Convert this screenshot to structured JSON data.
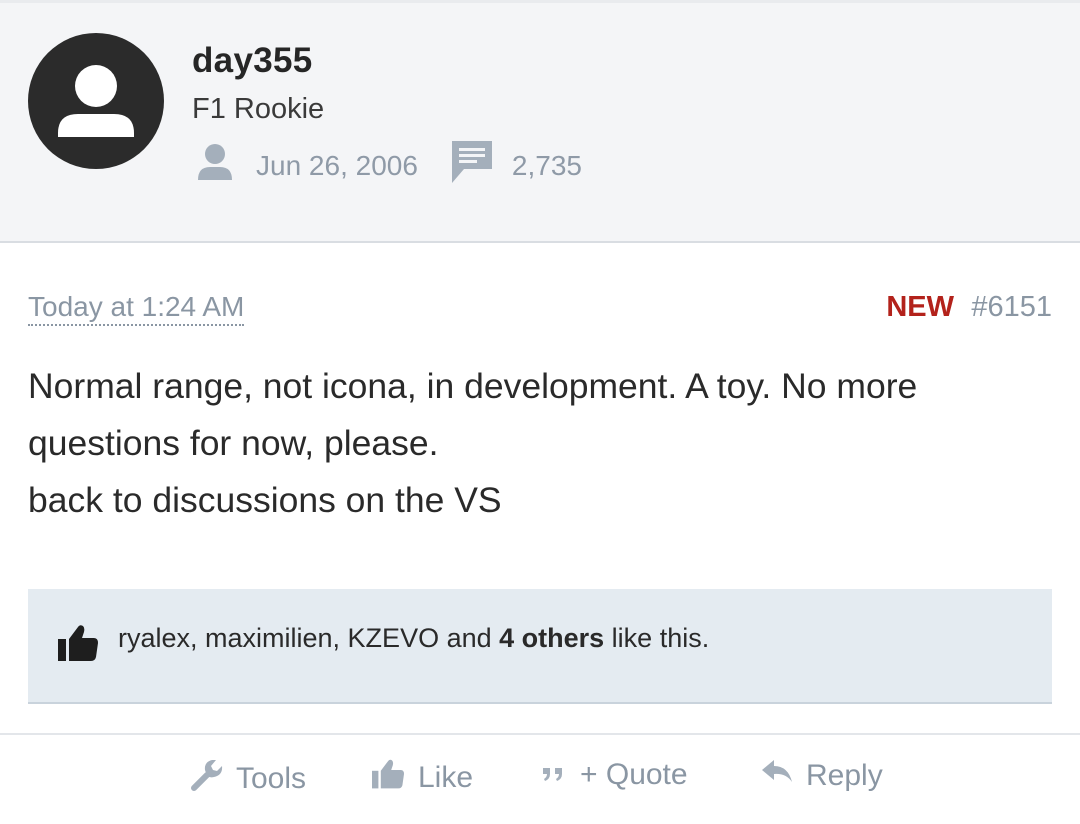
{
  "user": {
    "name": "day355",
    "title": "F1 Rookie",
    "join_date": "Jun 26, 2006",
    "message_count": "2,735"
  },
  "post": {
    "timestamp": "Today at 1:24 AM",
    "new_label": "NEW",
    "number": "#6151",
    "lines": [
      "Normal range, not icona, in development. A toy. No more",
      "questions for now, please.",
      "back to discussions on the VS"
    ]
  },
  "likes": {
    "names": "ryalex, maximilien, KZEVO and ",
    "others": "4 others",
    "suffix": " like this."
  },
  "actions": {
    "tools": "Tools",
    "like": "Like",
    "quote": "+ Quote",
    "reply": "Reply"
  },
  "colors": {
    "header_bg": "#f4f5f7",
    "likes_bg": "#e4ebf1",
    "new_badge": "#b3221b",
    "muted_text": "#8a96a3",
    "avatar_bg": "#2b2b2b"
  },
  "icons": [
    "avatar-icon",
    "person-icon",
    "message-icon",
    "thumbs-up-icon",
    "wrench-icon",
    "quote-icon",
    "reply-arrow-icon"
  ]
}
